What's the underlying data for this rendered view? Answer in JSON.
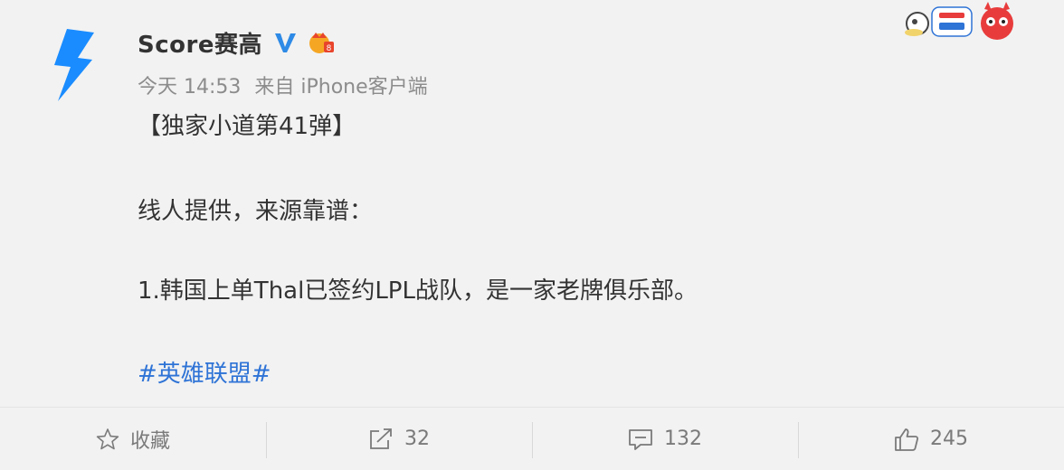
{
  "user": {
    "name": "Score赛高",
    "avatar_icon": "lightning-bolt-icon",
    "verified_icon": "blue-v-verified-icon",
    "vip_icon": "vip-crown-badge-icon"
  },
  "meta": {
    "time": "今天 14:53",
    "source": "来自 iPhone客户端"
  },
  "post": {
    "lines": [
      "【独家小道第41弹】",
      "线人提供，来源靠谱：",
      "1.韩国上单Thal已签约LPL战队，是一家老牌俱乐部。",
      "#英雄联盟#"
    ]
  },
  "actions": {
    "favorite": {
      "label": "收藏",
      "icon": "star-icon"
    },
    "repost": {
      "count": "32",
      "icon": "share-arrow-icon"
    },
    "comment": {
      "count": "132",
      "icon": "comment-bubble-icon"
    },
    "like": {
      "count": "245",
      "icon": "thumbs-up-icon"
    }
  },
  "colors": {
    "accent_blue": "#2e73d6",
    "avatar_blue": "#1a8cff",
    "meta_gray": "#8c8c8c"
  }
}
